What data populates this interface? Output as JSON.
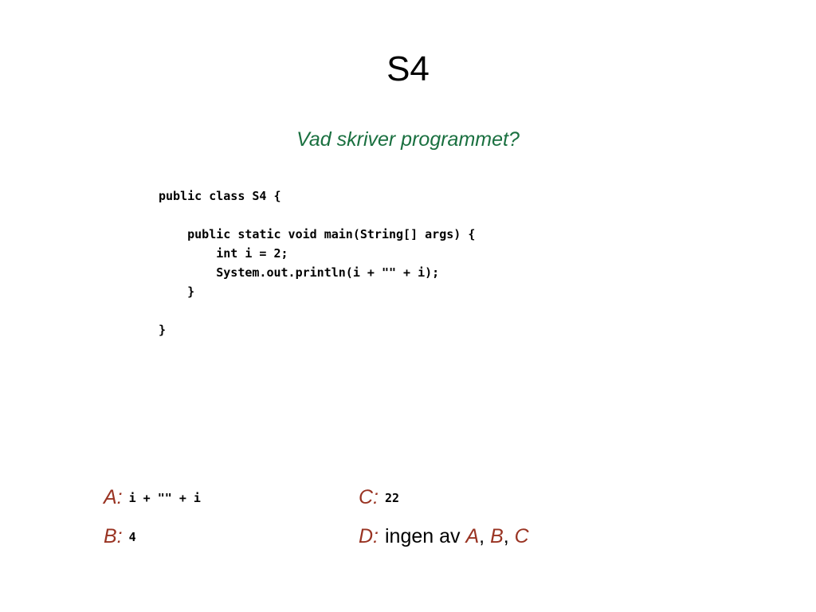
{
  "slide": {
    "title": "S4",
    "subtitle": "Vad skriver programmet?",
    "code": "public class S4 {\n\n    public static void main(String[] args) {\n        int i = 2;\n        System.out.println(i + \"\" + i);\n    }\n\n}",
    "colors": {
      "title": "#000000",
      "subtitle": "#1a7040",
      "option_label": "#993322",
      "code": "#000000",
      "background": "#ffffff"
    },
    "options": [
      {
        "label": "A:",
        "value": "i + \"\" + i",
        "style": "code"
      },
      {
        "label": "C:",
        "value": "22",
        "style": "code"
      },
      {
        "label": "B:",
        "value": "4",
        "style": "code"
      },
      {
        "label": "D:",
        "value": "ingen av A, B, C",
        "style": "text",
        "parts": {
          "lead": "ingen av ",
          "ref_a": "A",
          "comma1": ", ",
          "ref_b": "B",
          "comma2": ", ",
          "ref_c": "C"
        }
      }
    ]
  }
}
